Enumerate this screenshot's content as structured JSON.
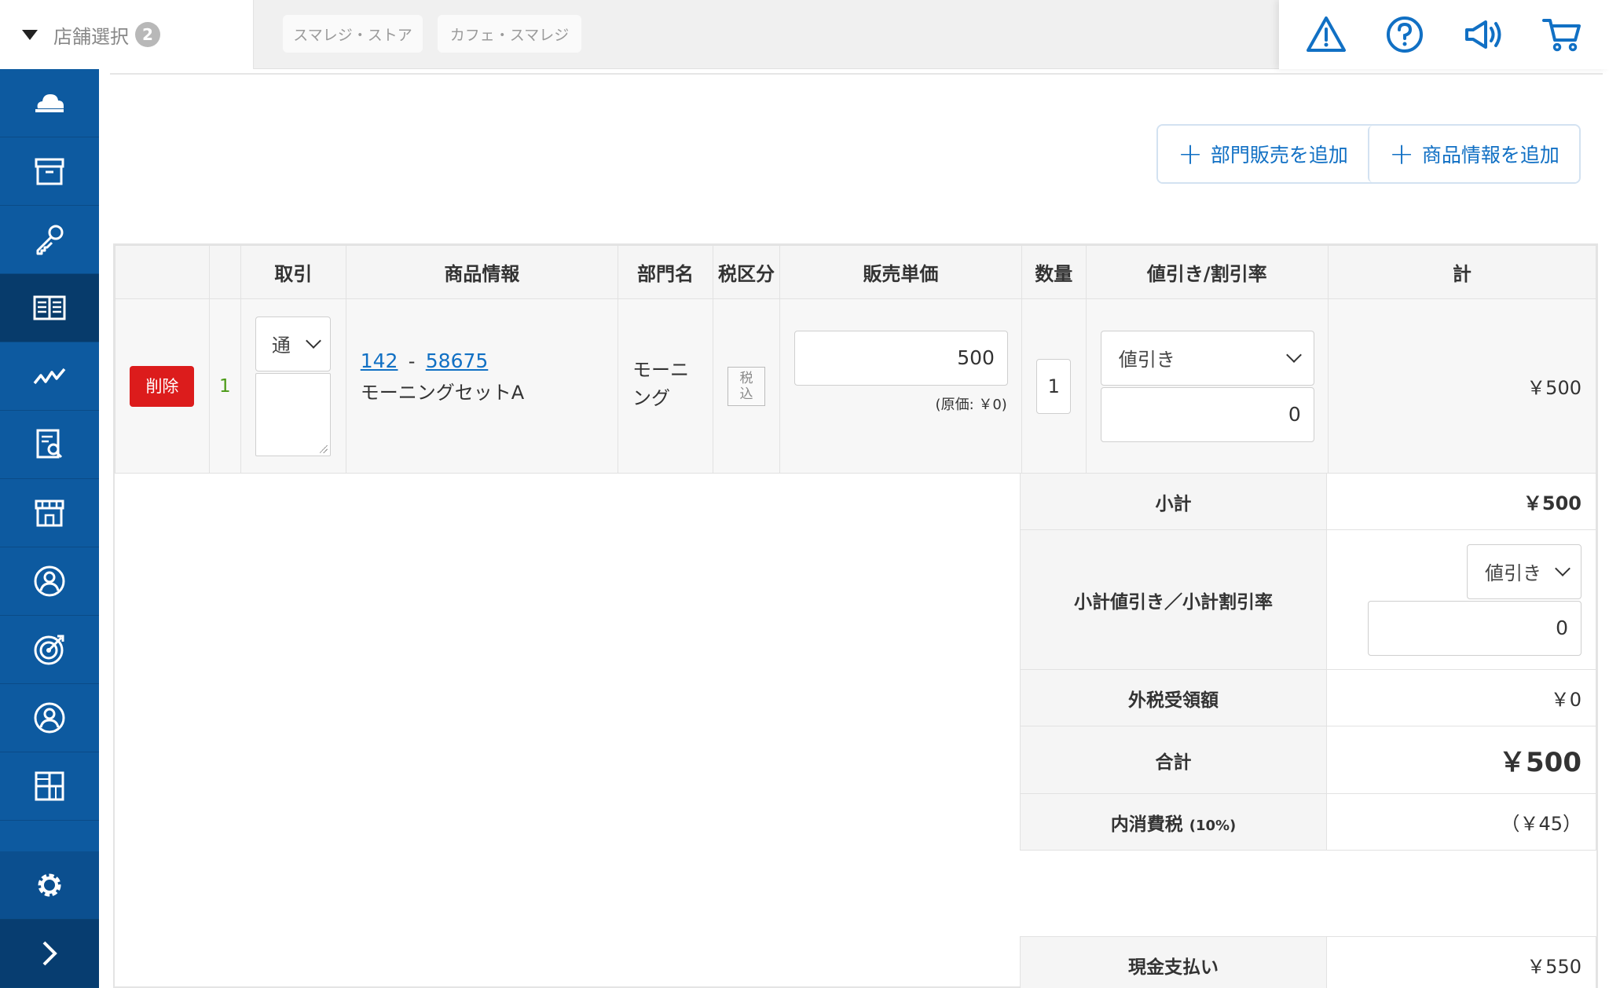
{
  "header": {
    "store_select_label": "店舗選択",
    "store_count": "2",
    "stores": [
      "スマレジ・ストア",
      "カフェ・スマレジ"
    ]
  },
  "toolbar": {
    "add_department_sale": "部門販売を追加",
    "add_product_info": "商品情報を追加"
  },
  "table": {
    "headers": {
      "deal": "取引",
      "product_info": "商品情報",
      "department": "部門名",
      "tax_category": "税区分",
      "unit_price": "販売単価",
      "quantity": "数量",
      "discount": "値引き/割引率",
      "total": "計"
    },
    "row": {
      "delete_label": "削除",
      "index": "1",
      "deal_type": "通",
      "product_code": "142",
      "separator": "-",
      "product_id": "58675",
      "product_name": "モーニングセットA",
      "department": "モーニング",
      "tax_label": "税込",
      "unit_price": "500",
      "cost_note": "(原価: ￥0)",
      "quantity": "1",
      "discount_type": "値引き",
      "discount_value": "0",
      "line_total": "￥500"
    }
  },
  "summary": {
    "subtotal_label": "小計",
    "subtotal_value": "￥500",
    "subtotal_discount_label": "小計値引き／小計割引率",
    "subtotal_discount_type": "値引き",
    "subtotal_discount_value": "0",
    "external_tax_label": "外税受領額",
    "external_tax_value": "￥0",
    "grand_total_label": "合計",
    "grand_total_value": "￥500",
    "internal_tax_label": "内消費税",
    "internal_tax_rate": "(10%)",
    "internal_tax_value": "（￥45）",
    "cash_payment_label": "現金支払い",
    "cash_payment_value": "￥550"
  }
}
